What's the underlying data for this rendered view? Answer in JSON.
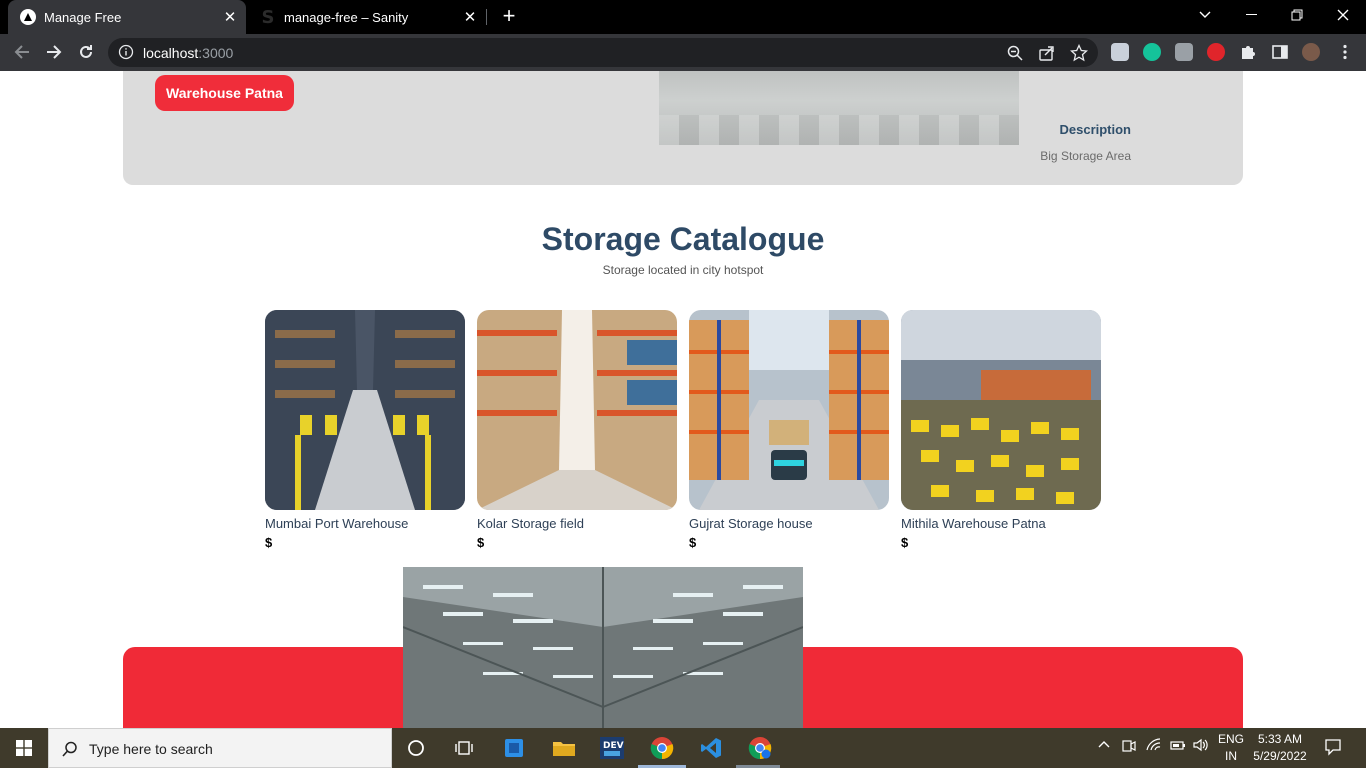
{
  "browser": {
    "tabs": [
      {
        "title": "Manage Free",
        "active": true
      },
      {
        "title": "manage-free – Sanity",
        "active": false
      }
    ],
    "url_host": "localhost",
    "url_port": ":3000"
  },
  "hero": {
    "button_label": "Warehouse Patna",
    "description_title": "Description",
    "description_text": "Big Storage Area"
  },
  "catalogue": {
    "title": "Storage Catalogue",
    "subtitle": "Storage located in city hotspot",
    "items": [
      {
        "name": "Mumbai Port Warehouse",
        "price": "$"
      },
      {
        "name": "Kolar Storage field",
        "price": "$"
      },
      {
        "name": "Gujrat Storage house",
        "price": "$"
      },
      {
        "name": "Mithila Warehouse Patna",
        "price": "$"
      }
    ]
  },
  "taskbar": {
    "search_placeholder": "Type here to search",
    "lang_top": "ENG",
    "lang_bottom": "IN",
    "time": "5:33 AM",
    "date": "5/29/2022"
  },
  "colors": {
    "accent_red": "#f02d3a",
    "heading_blue": "#2e4a66",
    "panel_gray": "#dcdcdc"
  }
}
